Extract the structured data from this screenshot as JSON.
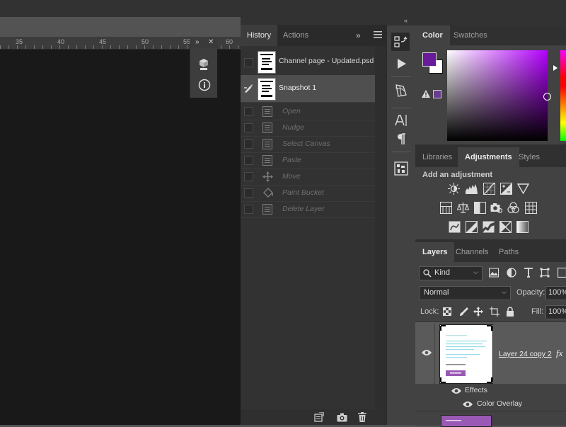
{
  "ruler": {
    "labels": [
      "35",
      "40",
      "45",
      "50",
      "55",
      "60"
    ]
  },
  "history": {
    "tabs": [
      "History",
      "Actions"
    ],
    "snapshots": [
      {
        "label": "Channel page - Updated.psd"
      },
      {
        "label": "Snapshot 1"
      }
    ],
    "steps": [
      {
        "label": "Open",
        "icon": "document-icon"
      },
      {
        "label": "Nudge",
        "icon": "document-icon"
      },
      {
        "label": "Select Canvas",
        "icon": "document-icon"
      },
      {
        "label": "Paste",
        "icon": "document-icon"
      },
      {
        "label": "Move",
        "icon": "move-icon"
      },
      {
        "label": "Paint Bucket",
        "icon": "paint-bucket-icon"
      },
      {
        "label": "Delete Layer",
        "icon": "document-icon"
      }
    ]
  },
  "color_panel": {
    "tabs": [
      "Color",
      "Swatches"
    ],
    "foreground_color": "#6a1b9a",
    "background_color": "#ffffff",
    "hue_color": "#b300ff"
  },
  "adjustments_panel": {
    "tabs": [
      "Libraries",
      "Adjustments",
      "Styles"
    ],
    "heading": "Add an adjustment"
  },
  "layers_panel": {
    "tabs": [
      "Layers",
      "Channels",
      "Paths"
    ],
    "filter_kind": "Kind",
    "blend_mode": "Normal",
    "opacity_label": "Opacity:",
    "opacity_value": "100%",
    "lock_label": "Lock:",
    "fill_label": "Fill:",
    "fill_value": "100%",
    "layer_name": "Layer 24 copy 2",
    "fx_label": "fx",
    "effects_label": "Effects",
    "effect_item": "Color Overlay"
  }
}
